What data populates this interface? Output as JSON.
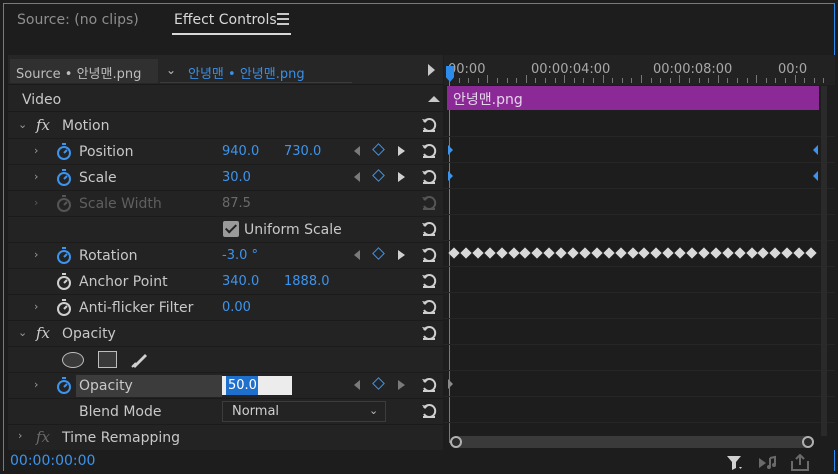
{
  "tabs": {
    "source": "Source: (no clips)",
    "effect_controls": "Effect Controls"
  },
  "source_bar": {
    "source_label": "Source • 안녕맨.png",
    "sequence_label": "안녕맨 • 안녕맨.png"
  },
  "timeline": {
    "ruler": [
      "00:00",
      "00:00:04:00",
      "00:00:08:00",
      "00:0"
    ],
    "clip_name": "안녕맨.png"
  },
  "section_video": "Video",
  "motion": {
    "label": "Motion",
    "position": {
      "label": "Position",
      "x": "940.0",
      "y": "730.0"
    },
    "scale": {
      "label": "Scale",
      "value": "30.0"
    },
    "scale_width": {
      "label": "Scale Width",
      "value": "87.5"
    },
    "uniform_scale": "Uniform Scale",
    "rotation": {
      "label": "Rotation",
      "value": "-3.0 °"
    },
    "anchor_point": {
      "label": "Anchor Point",
      "x": "340.0",
      "y": "1888.0"
    },
    "anti_flicker": {
      "label": "Anti-flicker Filter",
      "value": "0.00"
    }
  },
  "opacity": {
    "label": "Opacity",
    "opacity_prop": {
      "label": "Opacity",
      "value": "50.0"
    },
    "blend_mode": {
      "label": "Blend Mode",
      "value": "Normal"
    }
  },
  "time_remapping": "Time Remapping",
  "status": {
    "timecode": "00:00:00:00"
  },
  "colors": {
    "accent": "#2d8ceb",
    "clip": "#8b2a97",
    "value_blue": "#3d94ec"
  }
}
